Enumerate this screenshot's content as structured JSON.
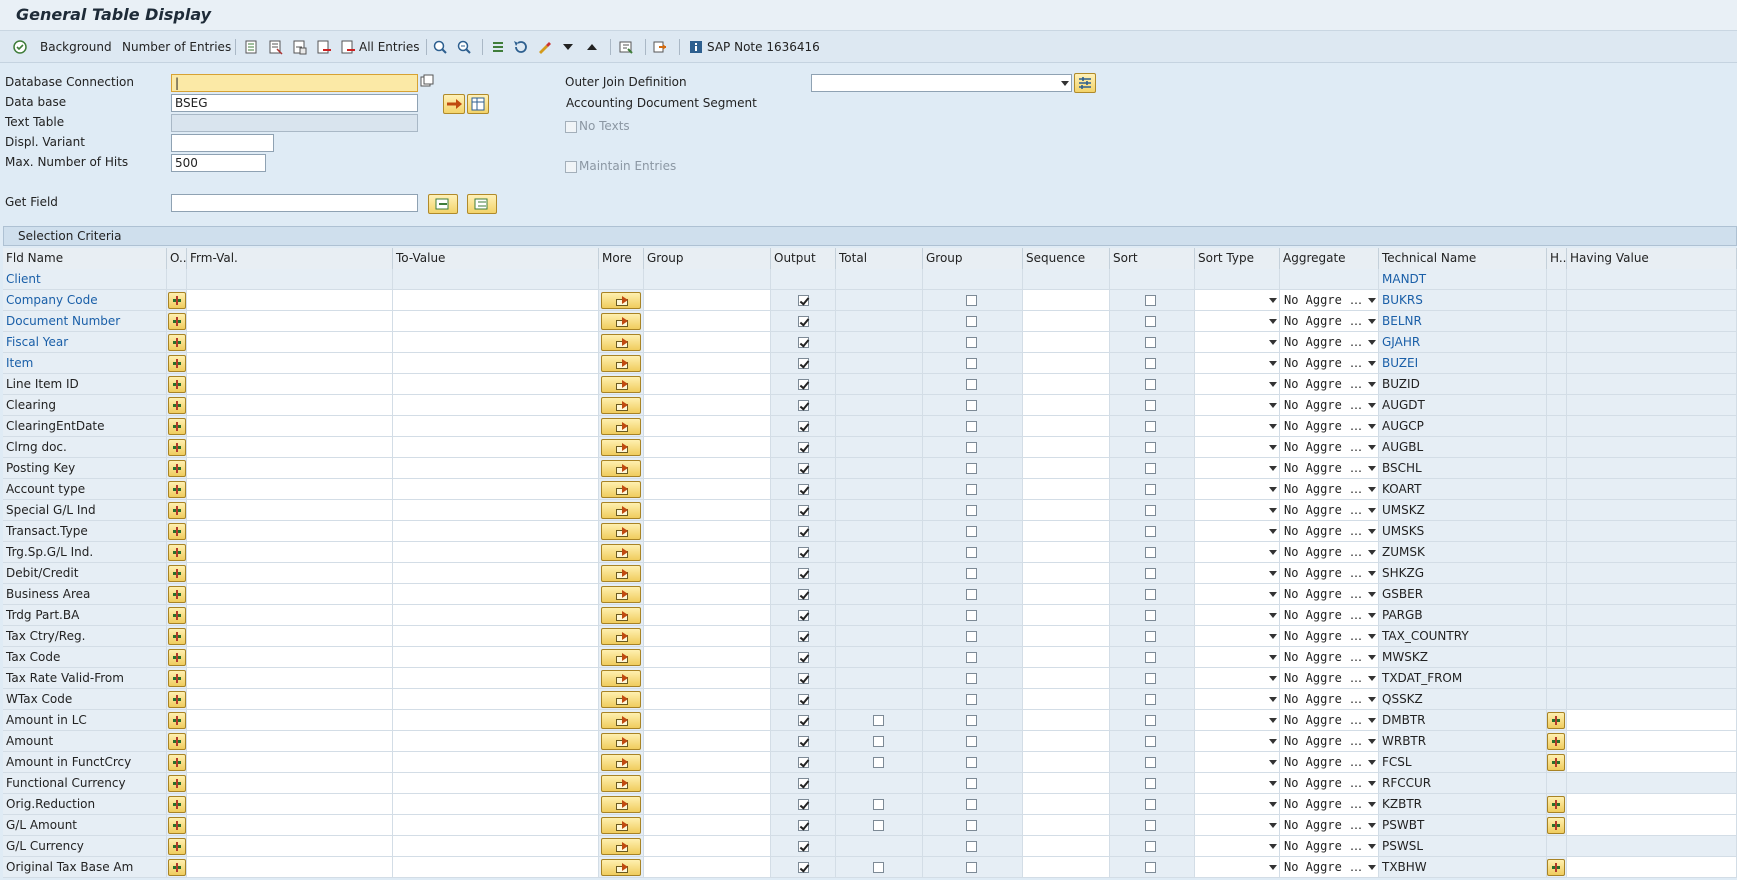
{
  "window": {
    "title": "General Table Display"
  },
  "toolbar": {
    "background": "Background",
    "number_of_entries": "Number of Entries",
    "all_entries": "All Entries",
    "sap_note": "SAP Note 1636416"
  },
  "form": {
    "database_connection_label": "Database Connection",
    "database_connection_value": "|",
    "data_base_label": "Data base",
    "data_base_value": "BSEG",
    "text_table_label": "Text Table",
    "text_table_value": "",
    "displ_variant_label": "Displ. Variant",
    "displ_variant_value": "",
    "max_hits_label": "Max. Number of Hits",
    "max_hits_value": "500",
    "get_field_label": "Get Field",
    "get_field_value": "",
    "outer_join_label": "Outer Join Definition",
    "outer_join_value": "",
    "table_description": "Accounting Document Segment",
    "no_texts_label": "No Texts",
    "maintain_entries_label": "Maintain Entries"
  },
  "section": {
    "title": "Selection Criteria"
  },
  "columns": [
    "Fld Name",
    "O..",
    "Frm-Val.",
    "To-Value",
    "More",
    "Group",
    "Output",
    "Total",
    "Group",
    "Sequence",
    "Sort",
    "Sort Type",
    "Aggregate",
    "Technical Name",
    "H..",
    "Having Value"
  ],
  "aggregate_default": "No Aggre",
  "rows": [
    {
      "name": "Client",
      "tech": "MANDT",
      "key": true,
      "output": false,
      "total": false,
      "having": false,
      "client": true
    },
    {
      "name": "Company Code",
      "tech": "BUKRS",
      "key": true,
      "output": true,
      "total": false,
      "having": false
    },
    {
      "name": "Document Number",
      "tech": "BELNR",
      "key": true,
      "output": true,
      "total": false,
      "having": false
    },
    {
      "name": "Fiscal Year",
      "tech": "GJAHR",
      "key": true,
      "output": true,
      "total": false,
      "having": false
    },
    {
      "name": "Item",
      "tech": "BUZEI",
      "key": true,
      "output": true,
      "total": false,
      "having": false
    },
    {
      "name": "Line Item ID",
      "tech": "BUZID",
      "key": false,
      "output": true,
      "total": false,
      "having": false
    },
    {
      "name": "Clearing",
      "tech": "AUGDT",
      "key": false,
      "output": true,
      "total": false,
      "having": false
    },
    {
      "name": "ClearingEntDate",
      "tech": "AUGCP",
      "key": false,
      "output": true,
      "total": false,
      "having": false
    },
    {
      "name": "Clrng doc.",
      "tech": "AUGBL",
      "key": false,
      "output": true,
      "total": false,
      "having": false
    },
    {
      "name": "Posting Key",
      "tech": "BSCHL",
      "key": false,
      "output": true,
      "total": false,
      "having": false
    },
    {
      "name": "Account type",
      "tech": "KOART",
      "key": false,
      "output": true,
      "total": false,
      "having": false
    },
    {
      "name": "Special G/L Ind",
      "tech": "UMSKZ",
      "key": false,
      "output": true,
      "total": false,
      "having": false
    },
    {
      "name": "Transact.Type",
      "tech": "UMSKS",
      "key": false,
      "output": true,
      "total": false,
      "having": false
    },
    {
      "name": "Trg.Sp.G/L Ind.",
      "tech": "ZUMSK",
      "key": false,
      "output": true,
      "total": false,
      "having": false
    },
    {
      "name": "Debit/Credit",
      "tech": "SHKZG",
      "key": false,
      "output": true,
      "total": false,
      "having": false
    },
    {
      "name": "Business Area",
      "tech": "GSBER",
      "key": false,
      "output": true,
      "total": false,
      "having": false
    },
    {
      "name": "Trdg Part.BA",
      "tech": "PARGB",
      "key": false,
      "output": true,
      "total": false,
      "having": false
    },
    {
      "name": "Tax Ctry/Reg.",
      "tech": "TAX_COUNTRY",
      "key": false,
      "output": true,
      "total": false,
      "having": false
    },
    {
      "name": "Tax Code",
      "tech": "MWSKZ",
      "key": false,
      "output": true,
      "total": false,
      "having": false
    },
    {
      "name": "Tax Rate Valid-From",
      "tech": "TXDAT_FROM",
      "key": false,
      "output": true,
      "total": false,
      "having": false
    },
    {
      "name": "WTax Code",
      "tech": "QSSKZ",
      "key": false,
      "output": true,
      "total": false,
      "having": false
    },
    {
      "name": "Amount in LC",
      "tech": "DMBTR",
      "key": false,
      "output": true,
      "total": true,
      "having": true
    },
    {
      "name": "Amount",
      "tech": "WRBTR",
      "key": false,
      "output": true,
      "total": true,
      "having": true
    },
    {
      "name": "Amount in FunctCrcy",
      "tech": "FCSL",
      "key": false,
      "output": true,
      "total": true,
      "having": true
    },
    {
      "name": "Functional Currency",
      "tech": "RFCCUR",
      "key": false,
      "output": true,
      "total": false,
      "having": false
    },
    {
      "name": "Orig.Reduction",
      "tech": "KZBTR",
      "key": false,
      "output": true,
      "total": true,
      "having": true
    },
    {
      "name": "G/L Amount",
      "tech": "PSWBT",
      "key": false,
      "output": true,
      "total": true,
      "having": true
    },
    {
      "name": "G/L Currency",
      "tech": "PSWSL",
      "key": false,
      "output": true,
      "total": false,
      "having": false
    },
    {
      "name": "Original Tax Base Am",
      "tech": "TXBHW",
      "key": false,
      "output": true,
      "total": true,
      "having": true
    }
  ]
}
